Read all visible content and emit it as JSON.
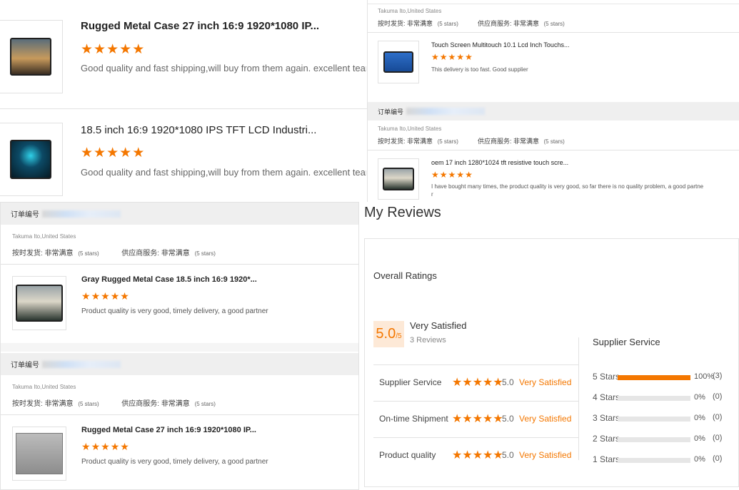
{
  "top_left_cards": [
    {
      "title": "Rugged Metal Case 27 inch 16:9 1920*1080 IP...",
      "stars": 5,
      "review": "Good quality and fast shipping,will buy from them again. excellent team!!!"
    },
    {
      "title": "18.5 inch 16:9 1920*1080 IPS TFT LCD Industri...",
      "stars": 5,
      "review": "Good quality and fast shipping,will buy from them again. excellent team!!!"
    }
  ],
  "top_right": {
    "buyer": "Takuma Ito,United States",
    "delivery_label": "按时发货:",
    "delivery_value": "非常满意",
    "delivery_stars": "(5 stars)",
    "service_label": "供应商服务:",
    "service_value": "非常满意",
    "service_stars": "(5 stars)",
    "items": [
      {
        "title": "Touch Screen Multitouch 10.1 Lcd Inch Touchs...",
        "review": "This delivery is too fast. Good supplier"
      }
    ],
    "order_label": "订单编号",
    "second_buyer": "Takuma Ito,United States",
    "second_item": {
      "title": "oem 17 inch 1280*1024 tft resistive touch scre...",
      "review": "I have bought many times, the product quality is very good, so far there is no quality problem, a good partne",
      "review_cont": "r"
    }
  },
  "bottom_left_orders": [
    {
      "order_label": "订单编号",
      "buyer": "Takuma Ito,United States",
      "delivery_label": "按时发货:",
      "delivery_value": "非常满意",
      "delivery_stars": "(5 stars)",
      "service_label": "供应商服务:",
      "service_value": "非常满意",
      "service_stars": "(5 stars)",
      "title": "Gray Rugged Metal Case 18.5 inch 16:9 1920*...",
      "review": "Product quality is very good, timely delivery, a good partner"
    },
    {
      "order_label": "订单编号",
      "buyer": "Takuma Ito,United States",
      "delivery_label": "按时发货:",
      "delivery_value": "非常满意",
      "delivery_stars": "(5 stars)",
      "service_label": "供应商服务:",
      "service_value": "非常满意",
      "service_stars": "(5 stars)",
      "title": "Rugged Metal Case 27 inch 16:9 1920*1080 IP...",
      "review": "Product quality is very good, timely delivery, a good partner"
    }
  ],
  "my_reviews": {
    "heading": "My Reviews",
    "overall_label": "Overall Ratings",
    "score": "5.0",
    "score_max": "/5",
    "satisfaction": "Very Satisfied",
    "review_count": "3 Reviews",
    "categories": [
      {
        "label": "Supplier Service",
        "stars": 5,
        "score": "5.0",
        "verdict": "Very Satisfied"
      },
      {
        "label": "On-time Shipment",
        "stars": 5,
        "score": "5.0",
        "verdict": "Very Satisfied"
      },
      {
        "label": "Product quality",
        "stars": 5,
        "score": "5.0",
        "verdict": "Very Satisfied"
      }
    ],
    "breakdown_title": "Supplier Service",
    "breakdown": [
      {
        "label": "5 Stars",
        "percent": "100%",
        "count": "(3)",
        "fraction": 1.0
      },
      {
        "label": "4 Stars",
        "percent": "0%",
        "count": "(0)",
        "fraction": 0
      },
      {
        "label": "3 Stars",
        "percent": "0%",
        "count": "(0)",
        "fraction": 0
      },
      {
        "label": "2 Stars",
        "percent": "0%",
        "count": "(0)",
        "fraction": 0
      },
      {
        "label": "1 Stars",
        "percent": "0%",
        "count": "(0)",
        "fraction": 0
      }
    ]
  },
  "colors": {
    "accent": "#f47700",
    "score_bg": "#fde9d7"
  },
  "icons": {
    "star": "star-icon"
  }
}
